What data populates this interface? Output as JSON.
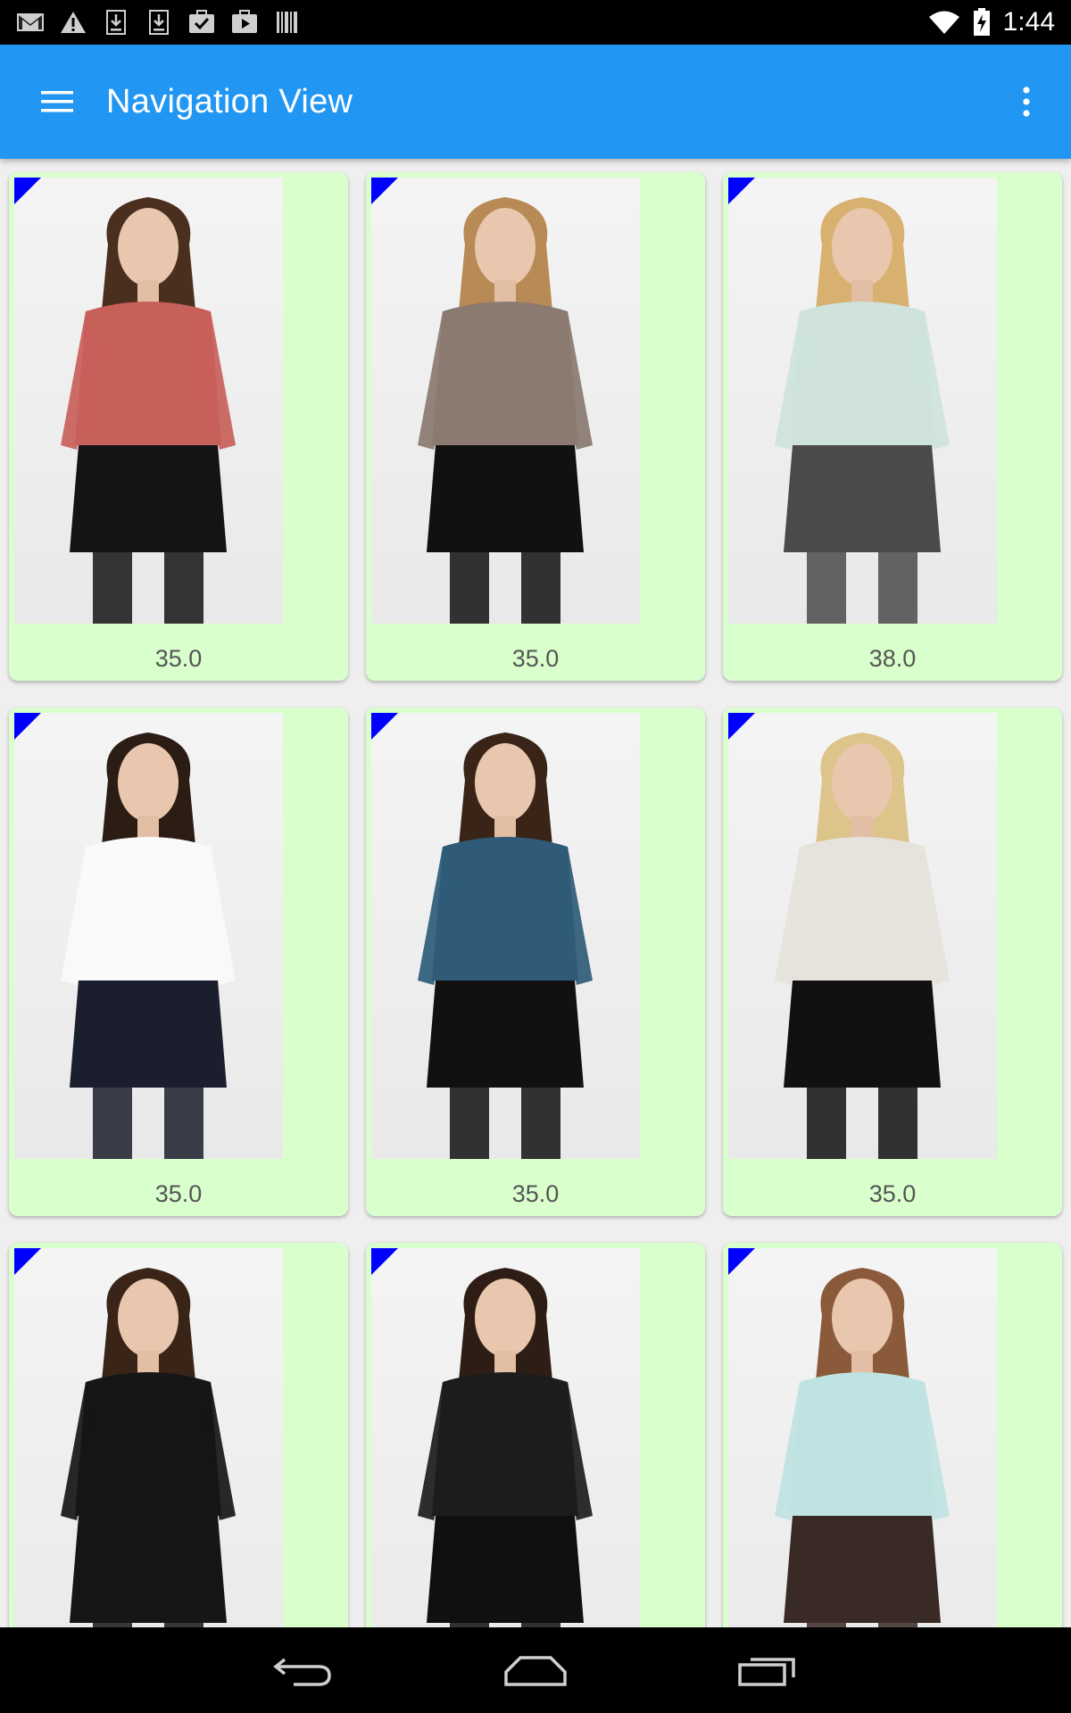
{
  "status_bar": {
    "time": "1:44",
    "left_icons": [
      "gmail-icon",
      "warning-icon",
      "download-icon",
      "download-icon",
      "task-icon",
      "play-store-icon",
      "barcode-icon"
    ],
    "right_icons": [
      "wifi-icon",
      "battery-charging-icon"
    ]
  },
  "app_bar": {
    "title": "Navigation View",
    "menu_icon": "hamburger-menu-icon",
    "overflow_icon": "more-vert-icon",
    "color": "#2196F3"
  },
  "products": [
    {
      "price": "35.0",
      "top_color": "#C8605A",
      "bottom_color": "#141414",
      "hair_color": "#4a2e1e"
    },
    {
      "price": "35.0",
      "top_color": "#8a7a70",
      "bottom_color": "#111111",
      "hair_color": "#b88a55"
    },
    {
      "price": "38.0",
      "top_color": "#cfe3dc",
      "bottom_color": "#4a4a4a",
      "hair_color": "#d8b070"
    },
    {
      "price": "35.0",
      "top_color": "#fafafa",
      "bottom_color": "#1b1e2c",
      "hair_color": "#2b1c14"
    },
    {
      "price": "35.0",
      "top_color": "#2f5b78",
      "bottom_color": "#111111",
      "hair_color": "#3a2418"
    },
    {
      "price": "35.0",
      "top_color": "#e6e3dc",
      "bottom_color": "#111111",
      "hair_color": "#dcc48a"
    },
    {
      "price": "",
      "top_color": "#161616",
      "bottom_color": "#161616",
      "hair_color": "#3a2418"
    },
    {
      "price": "",
      "top_color": "#1c1c1c",
      "bottom_color": "#101010",
      "hair_color": "#2e1d14"
    },
    {
      "price": "",
      "top_color": "#bfe3e2",
      "bottom_color": "#3a2a26",
      "hair_color": "#8a5a3a"
    }
  ],
  "card_style": {
    "background": "#D9FFCC",
    "corner_marker": "#0000FF"
  },
  "nav_bar": {
    "buttons": [
      "back-icon",
      "home-icon",
      "recents-icon"
    ]
  }
}
